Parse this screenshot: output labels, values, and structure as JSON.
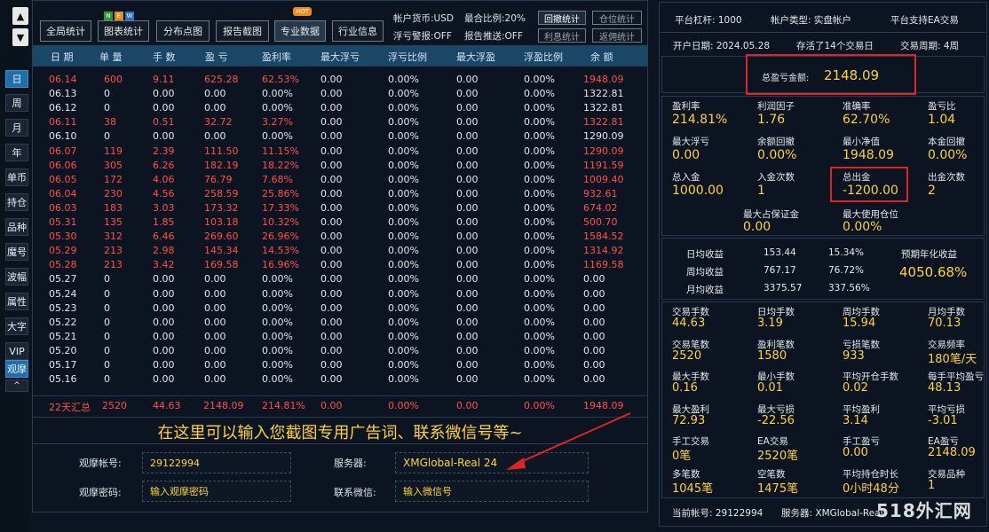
{
  "leftbar": {
    "scroll_up": "▲",
    "scroll_down": "▼",
    "buttons": [
      "日",
      "周",
      "月",
      "年",
      "单币",
      "持仓",
      "品种",
      "魔号",
      "波幅",
      "属性",
      "大字",
      "VIP",
      "观摩",
      "^"
    ]
  },
  "toolbar": {
    "buttons": [
      "全局统计",
      "图表统计",
      "分布点图",
      "报告截图",
      "专业数据",
      "行业信息"
    ],
    "new_badge": [
      "N",
      "E",
      "W"
    ],
    "hot_badge": "HOT",
    "currency": "帐户货币:USD",
    "max_ratio": "最合比例:20%",
    "float_warn": "浮亏警报:OFF",
    "report_push": "报告推送:OFF",
    "small_buttons": [
      "回撤统计",
      "仓位统计",
      "利息统计",
      "返佣统计"
    ]
  },
  "table": {
    "headers": [
      "日 期",
      "单 量",
      "手 数",
      "盈 亏",
      "盈利率",
      "最大浮亏",
      "浮亏比例",
      "最大浮盈",
      "浮盈比例",
      "余 额"
    ],
    "rows": [
      {
        "c": [
          "06.14",
          "600",
          "9.11",
          "625.28",
          "62.53%",
          "0.00",
          "0.00%",
          "0.00",
          "0.00%",
          "1948.09"
        ],
        "red": true
      },
      {
        "c": [
          "06.13",
          "0",
          "0.00",
          "0.00",
          "0.00%",
          "0.00",
          "0.00%",
          "0.00",
          "0.00%",
          "1322.81"
        ],
        "red": false
      },
      {
        "c": [
          "06.12",
          "0",
          "0.00",
          "0.00",
          "0.00%",
          "0.00",
          "0.00%",
          "0.00",
          "0.00%",
          "1322.81"
        ],
        "red": false
      },
      {
        "c": [
          "06.11",
          "38",
          "0.51",
          "32.72",
          "3.27%",
          "0.00",
          "0.00%",
          "0.00",
          "0.00%",
          "1322.81"
        ],
        "red": true
      },
      {
        "c": [
          "06.10",
          "0",
          "0.00",
          "0.00",
          "0.00%",
          "0.00",
          "0.00%",
          "0.00",
          "0.00%",
          "1290.09"
        ],
        "red": false
      },
      {
        "c": [
          "06.07",
          "119",
          "2.39",
          "111.50",
          "11.15%",
          "0.00",
          "0.00%",
          "0.00",
          "0.00%",
          "1290.09"
        ],
        "red": true
      },
      {
        "c": [
          "06.06",
          "305",
          "6.26",
          "182.19",
          "18.22%",
          "0.00",
          "0.00%",
          "0.00",
          "0.00%",
          "1191.59"
        ],
        "red": true
      },
      {
        "c": [
          "06.05",
          "172",
          "4.06",
          "76.79",
          "7.68%",
          "0.00",
          "0.00%",
          "0.00",
          "0.00%",
          "1009.40"
        ],
        "red": true
      },
      {
        "c": [
          "06.04",
          "230",
          "4.56",
          "258.59",
          "25.86%",
          "0.00",
          "0.00%",
          "0.00",
          "0.00%",
          "932.61"
        ],
        "red": true
      },
      {
        "c": [
          "06.03",
          "183",
          "3.03",
          "173.32",
          "17.33%",
          "0.00",
          "0.00%",
          "0.00",
          "0.00%",
          "674.02"
        ],
        "red": true
      },
      {
        "c": [
          "05.31",
          "135",
          "1.85",
          "103.18",
          "10.32%",
          "0.00",
          "0.00%",
          "0.00",
          "0.00%",
          "500.70"
        ],
        "red": true
      },
      {
        "c": [
          "05.30",
          "312",
          "6.46",
          "269.60",
          "26.96%",
          "0.00",
          "0.00%",
          "0.00",
          "0.00%",
          "1584.52"
        ],
        "red": true
      },
      {
        "c": [
          "05.29",
          "213",
          "2.98",
          "145.34",
          "14.53%",
          "0.00",
          "0.00%",
          "0.00",
          "0.00%",
          "1314.92"
        ],
        "red": true
      },
      {
        "c": [
          "05.28",
          "213",
          "3.42",
          "169.58",
          "16.96%",
          "0.00",
          "0.00%",
          "0.00",
          "0.00%",
          "1169.58"
        ],
        "red": true
      },
      {
        "c": [
          "05.27",
          "0",
          "0.00",
          "0.00",
          "0.00%",
          "0.00",
          "0.00%",
          "0.00",
          "0.00%",
          "0.00"
        ],
        "red": false
      },
      {
        "c": [
          "05.24",
          "0",
          "0.00",
          "0.00",
          "0.00%",
          "0.00",
          "0.00%",
          "0.00",
          "0.00%",
          "0.00"
        ],
        "red": false
      },
      {
        "c": [
          "05.23",
          "0",
          "0.00",
          "0.00",
          "0.00%",
          "0.00",
          "0.00%",
          "0.00",
          "0.00%",
          "0.00"
        ],
        "red": false
      },
      {
        "c": [
          "05.22",
          "0",
          "0.00",
          "0.00",
          "0.00%",
          "0.00",
          "0.00%",
          "0.00",
          "0.00%",
          "0.00"
        ],
        "red": false
      },
      {
        "c": [
          "05.21",
          "0",
          "0.00",
          "0.00",
          "0.00%",
          "0.00",
          "0.00%",
          "0.00",
          "0.00%",
          "0.00"
        ],
        "red": false
      },
      {
        "c": [
          "05.20",
          "0",
          "0.00",
          "0.00",
          "0.00%",
          "0.00",
          "0.00%",
          "0.00",
          "0.00%",
          "0.00"
        ],
        "red": false
      },
      {
        "c": [
          "05.17",
          "0",
          "0.00",
          "0.00",
          "0.00%",
          "0.00",
          "0.00%",
          "0.00",
          "0.00%",
          "0.00"
        ],
        "red": false
      },
      {
        "c": [
          "05.16",
          "0",
          "0.00",
          "0.00",
          "0.00%",
          "0.00",
          "0.00%",
          "0.00",
          "0.00%",
          "0.00"
        ],
        "red": false
      }
    ],
    "summary": [
      "22天汇总",
      "2520",
      "44.63",
      "2148.09",
      "214.81%",
      "0.00",
      "0.00%",
      "0.00",
      "0.00%",
      "1948.09"
    ]
  },
  "ad_text": "在这里可以输入您截图专用广告词、联系微信号等~",
  "form": {
    "account_label": "观摩帐号:",
    "account_value": "29122994",
    "server_label": "服务器:",
    "server_value": "XMGlobal-Real 24",
    "password_label": "观摩密码:",
    "password_placeholder": "输入观摩密码",
    "wechat_label": "联系微信:",
    "wechat_placeholder": "输入微信号"
  },
  "right": {
    "leverage": "平台杠杆: 1000",
    "acct_type": "帐户类型: 实盘帐户",
    "ea_support": "平台支持EA交易",
    "open_date": "开户日期: 2024.05.28",
    "alive_days": "存活了14个交易日",
    "trade_cycle": "交易周期: 4周",
    "total_pl_label": "总盈亏金额:",
    "total_pl_value": "2148.09",
    "stats1": [
      {
        "l": "盈利率",
        "v": "214.81%"
      },
      {
        "l": "利润因子",
        "v": "1.76"
      },
      {
        "l": "准确率",
        "v": "62.70%"
      },
      {
        "l": "盈亏比",
        "v": "1.04"
      },
      {
        "l": "最大浮亏",
        "v": "0.00"
      },
      {
        "l": "余额回撤",
        "v": "0.00%"
      },
      {
        "l": "最小净值",
        "v": "1948.09"
      },
      {
        "l": "本金回撤",
        "v": "0.00%"
      },
      {
        "l": "总入金",
        "v": "1000.00"
      },
      {
        "l": "入金次数",
        "v": "1"
      },
      {
        "l": "总出金",
        "v": "-1200.00"
      },
      {
        "l": "出金次数",
        "v": "2"
      }
    ],
    "margin": [
      {
        "l": "最大占保证金",
        "v": "0.00"
      },
      {
        "l": "最大使用仓位",
        "v": "0.00%"
      }
    ],
    "daily": {
      "label": "日均收益",
      "v1": "153.44",
      "v2": "15.34%"
    },
    "weekly": {
      "label": "周均收益",
      "v1": "767.17",
      "v2": "76.72%"
    },
    "monthly": {
      "label": "月均收益",
      "v1": "3375.57",
      "v2": "337.56%"
    },
    "annual_label": "预期年化收益",
    "annual_value": "4050.68%",
    "stats2": [
      {
        "l": "交易手数",
        "v": "44.63"
      },
      {
        "l": "日均手数",
        "v": "3.19"
      },
      {
        "l": "周均手数",
        "v": "15.94"
      },
      {
        "l": "月均手数",
        "v": "70.13"
      },
      {
        "l": "交易笔数",
        "v": "2520"
      },
      {
        "l": "盈利笔数",
        "v": "1580"
      },
      {
        "l": "亏损笔数",
        "v": "933"
      },
      {
        "l": "交易频率",
        "v": "180笔/天"
      },
      {
        "l": "最大手数",
        "v": "0.16"
      },
      {
        "l": "最小手数",
        "v": "0.01"
      },
      {
        "l": "平均开仓手数",
        "v": "0.02"
      },
      {
        "l": "每手平均盈亏",
        "v": "48.13"
      },
      {
        "l": "最大盈利",
        "v": "72.93"
      },
      {
        "l": "最大亏损",
        "v": "-22.56"
      },
      {
        "l": "平均盈利",
        "v": "3.14"
      },
      {
        "l": "平均亏损",
        "v": "-3.01"
      },
      {
        "l": "手工交易",
        "v": "0笔"
      },
      {
        "l": "EA交易",
        "v": "2520笔"
      },
      {
        "l": "手工盈亏",
        "v": "0.00"
      },
      {
        "l": "EA盈亏",
        "v": "2148.09"
      },
      {
        "l": "多笔数",
        "v": "1045笔"
      },
      {
        "l": "空笔数",
        "v": "1475笔"
      },
      {
        "l": "平均持仓时长",
        "v": "0小时48分"
      },
      {
        "l": "交易品种",
        "v": "1"
      }
    ],
    "footer_account": "当前帐号: 29122994",
    "footer_server": "服务器: XMGlobal-Real"
  },
  "watermark": "518外汇网",
  "colors": {
    "accent_blue": "#1a4766",
    "profit_red": "#ff4f4f",
    "value_yellow": "#ffd23a",
    "highlight_box": "#e02424"
  }
}
